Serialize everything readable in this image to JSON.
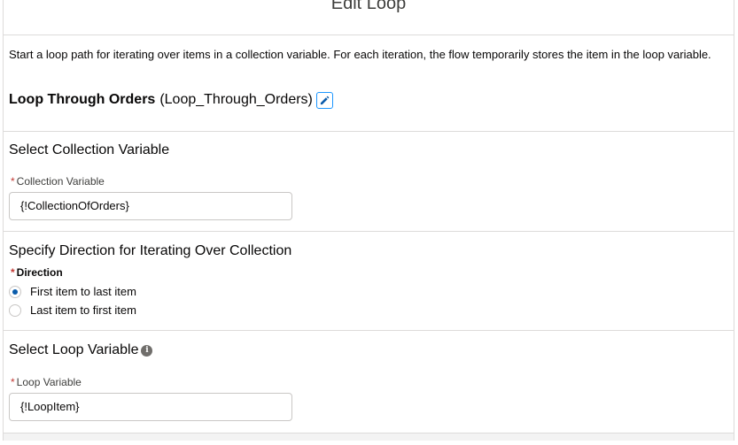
{
  "header": {
    "title": "Edit Loop"
  },
  "intro": {
    "text": "Start a loop path for iterating over items in a collection variable. For each iteration, the flow temporarily stores the item in the loop variable."
  },
  "loop": {
    "label": "Loop Through Orders",
    "api_name": "(Loop_Through_Orders)",
    "edit_icon": "pencil-icon"
  },
  "collection_section": {
    "title": "Select Collection Variable",
    "field_label": "Collection Variable",
    "required_marker": "*",
    "value": "{!CollectionOfOrders}"
  },
  "direction_section": {
    "title": "Specify Direction for Iterating Over Collection",
    "field_label": "Direction",
    "required_marker": "*",
    "options": [
      {
        "label": "First item to last item",
        "selected": true
      },
      {
        "label": "Last item to first item",
        "selected": false
      }
    ]
  },
  "loop_variable_section": {
    "title": "Select Loop Variable",
    "info_icon": "info-icon",
    "field_label": "Loop Variable",
    "required_marker": "*",
    "value": "{!LoopItem}"
  },
  "colors": {
    "accent": "#0b5cab",
    "required": "#c23934",
    "border": "#dddbda"
  }
}
